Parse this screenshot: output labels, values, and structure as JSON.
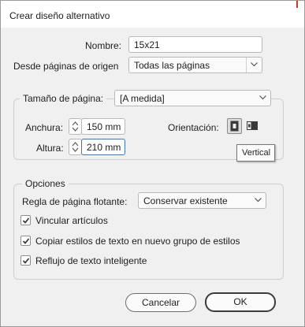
{
  "dialog": {
    "title": "Crear diseño alternativo"
  },
  "name": {
    "label": "Nombre:",
    "value": "15x21"
  },
  "source": {
    "label": "Desde páginas de origen",
    "value": "Todas las páginas"
  },
  "page_size": {
    "label": "Tamaño de página:",
    "value": "[A medida]"
  },
  "width": {
    "label": "Anchura:",
    "value": "150 mm"
  },
  "height": {
    "label": "Altura:",
    "value": "210 mm"
  },
  "orientation": {
    "label": "Orientación:",
    "selected": "portrait",
    "tooltip": "Vertical"
  },
  "options": {
    "legend": "Opciones",
    "liquid_rule_label": "Regla de página flotante:",
    "liquid_rule_value": "Conservar existente",
    "checkboxes": [
      {
        "label": "Vincular artículos",
        "checked": true
      },
      {
        "label": "Copiar estilos de texto en nuevo grupo de estilos",
        "checked": true
      },
      {
        "label": "Reflujo de texto inteligente",
        "checked": true
      }
    ]
  },
  "buttons": {
    "cancel": "Cancelar",
    "ok": "OK"
  },
  "colors": {
    "dialog_bg": "#f0f0f0",
    "focus_border": "#3b78c4",
    "title_accent": "#c0392b"
  }
}
